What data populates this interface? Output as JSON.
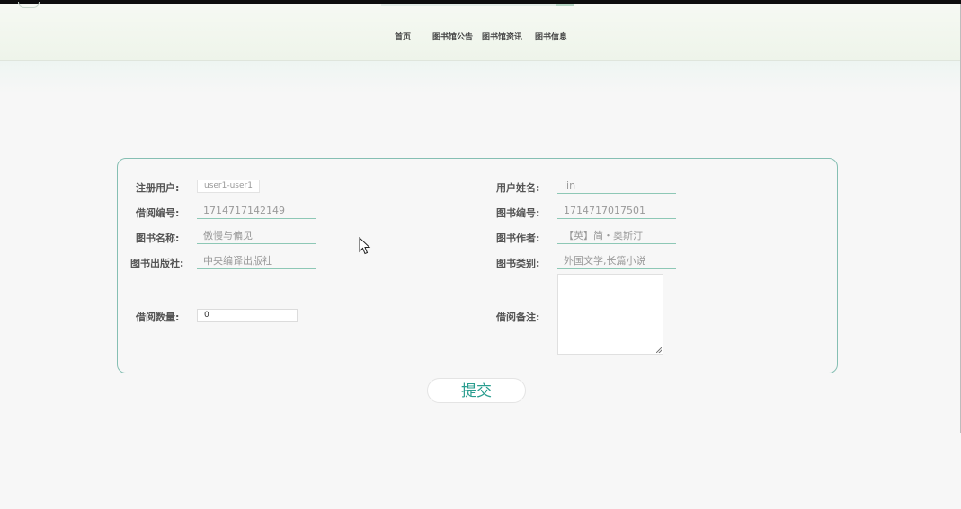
{
  "nav": {
    "items": [
      {
        "label": "首页"
      },
      {
        "label": "图书馆公告"
      },
      {
        "label": "图书馆资讯"
      },
      {
        "label": "图书信息"
      }
    ]
  },
  "form": {
    "registered_user": {
      "label": "注册用户:",
      "value": "user1-user1"
    },
    "user_name": {
      "label": "用户姓名:",
      "value": "lin"
    },
    "borrow_no": {
      "label": "借阅编号:",
      "value": "1714717142149"
    },
    "book_no": {
      "label": "图书编号:",
      "value": "1714717017501"
    },
    "book_name": {
      "label": "图书名称:",
      "value": "傲慢与偏见"
    },
    "book_author": {
      "label": "图书作者:",
      "value": "【英】简・奥斯汀"
    },
    "publisher": {
      "label": "图书出版社:",
      "value": "中央编译出版社"
    },
    "category": {
      "label": "图书类别:",
      "value": "外国文学,长篇小说"
    },
    "borrow_qty": {
      "label": "借阅数量:",
      "value": "0"
    },
    "borrow_note": {
      "label": "借阅备注:",
      "value": ""
    }
  },
  "submit_label": "提交",
  "colors": {
    "accent": "#2a9d8f",
    "border": "#86bfb3"
  }
}
